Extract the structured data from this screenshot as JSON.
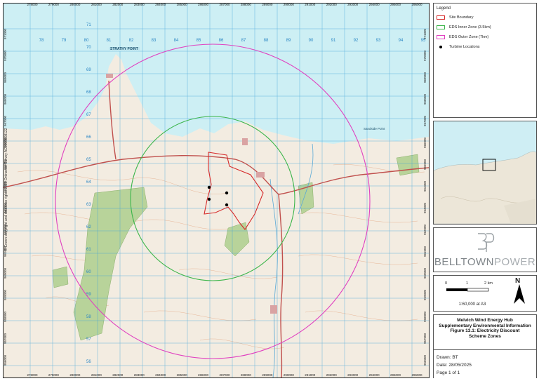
{
  "map": {
    "copyright": "© Crown copyright and database rights 2025 Ordnance Survey AC0000808122",
    "top_ticks": [
      "278000",
      "279000",
      "280000",
      "281000",
      "282000",
      "283000",
      "284000",
      "285000",
      "286000",
      "287000",
      "288000",
      "289000",
      "290000",
      "291000",
      "292000",
      "293000",
      "294000",
      "295000",
      "296000"
    ],
    "bottom_ticks": [
      "278000",
      "279000",
      "280000",
      "281000",
      "282000",
      "283000",
      "284000",
      "285000",
      "286000",
      "287000",
      "288000",
      "289000",
      "290000",
      "291000",
      "292000",
      "293000",
      "294000",
      "295000",
      "296000"
    ],
    "left_ticks": [
      "971000",
      "970000",
      "969000",
      "968000",
      "967000",
      "966000",
      "965000",
      "964000",
      "963000",
      "962000",
      "961000",
      "960000",
      "959000",
      "958000",
      "957000",
      "956000"
    ],
    "right_ticks": [
      "971000",
      "970000",
      "969000",
      "968000",
      "967000",
      "966000",
      "965000",
      "964000",
      "963000",
      "962000",
      "961000",
      "960000",
      "959000",
      "958000",
      "957000",
      "956000"
    ],
    "place_labels": {
      "strathy_point": "STRATHY POINT",
      "sandside": "Sandside Point"
    },
    "grid_numbers_top": [
      "78",
      "79",
      "80",
      "81",
      "82",
      "83",
      "84",
      "85",
      "86",
      "87",
      "88",
      "89",
      "90",
      "91",
      "92",
      "93",
      "94",
      "95",
      "96"
    ],
    "grid_numbers_left": [
      "71",
      "70",
      "69",
      "68",
      "67",
      "66",
      "65",
      "64",
      "63",
      "62",
      "61",
      "60",
      "59",
      "58",
      "57",
      "56"
    ],
    "colors": {
      "sea": "#cdeff4",
      "land": "#f3ece1",
      "grid": "#3aa0d8",
      "contour": "#e4a884",
      "road": "#c0504d",
      "forest": "#b8d39a",
      "site": "#d62b2b",
      "inner_zone": "#3bb54a",
      "outer_zone": "#e040c0"
    }
  },
  "legend": {
    "title": "Legend",
    "items": [
      {
        "label": "Site Boundary",
        "kind": "rect",
        "color": "#d62b2b"
      },
      {
        "label": "EDS Inner Zone (3.5km)",
        "kind": "rect",
        "color": "#3bb54a"
      },
      {
        "label": "EDS Outer Zone (7km)",
        "kind": "rect",
        "color": "#e040c0"
      },
      {
        "label": "Turbine Locations",
        "kind": "dot",
        "color": "#000000"
      }
    ]
  },
  "logo": {
    "part1": "BELLTOWN",
    "part2": "POWER"
  },
  "scale": {
    "labels": [
      "0",
      "1",
      "2 km"
    ],
    "ratio": "1:60,000  at A3",
    "north": "N"
  },
  "title_block": {
    "lines": [
      "Melvich Wind Energy Hub",
      "Supplementary Environmental Information",
      "Figure 13.1: Electricity Discount",
      "Scheme Zones"
    ]
  },
  "meta": {
    "drawn": "Drawn: BT",
    "date": "Date: 28/05/2025",
    "page": "Page 1 of 1"
  }
}
